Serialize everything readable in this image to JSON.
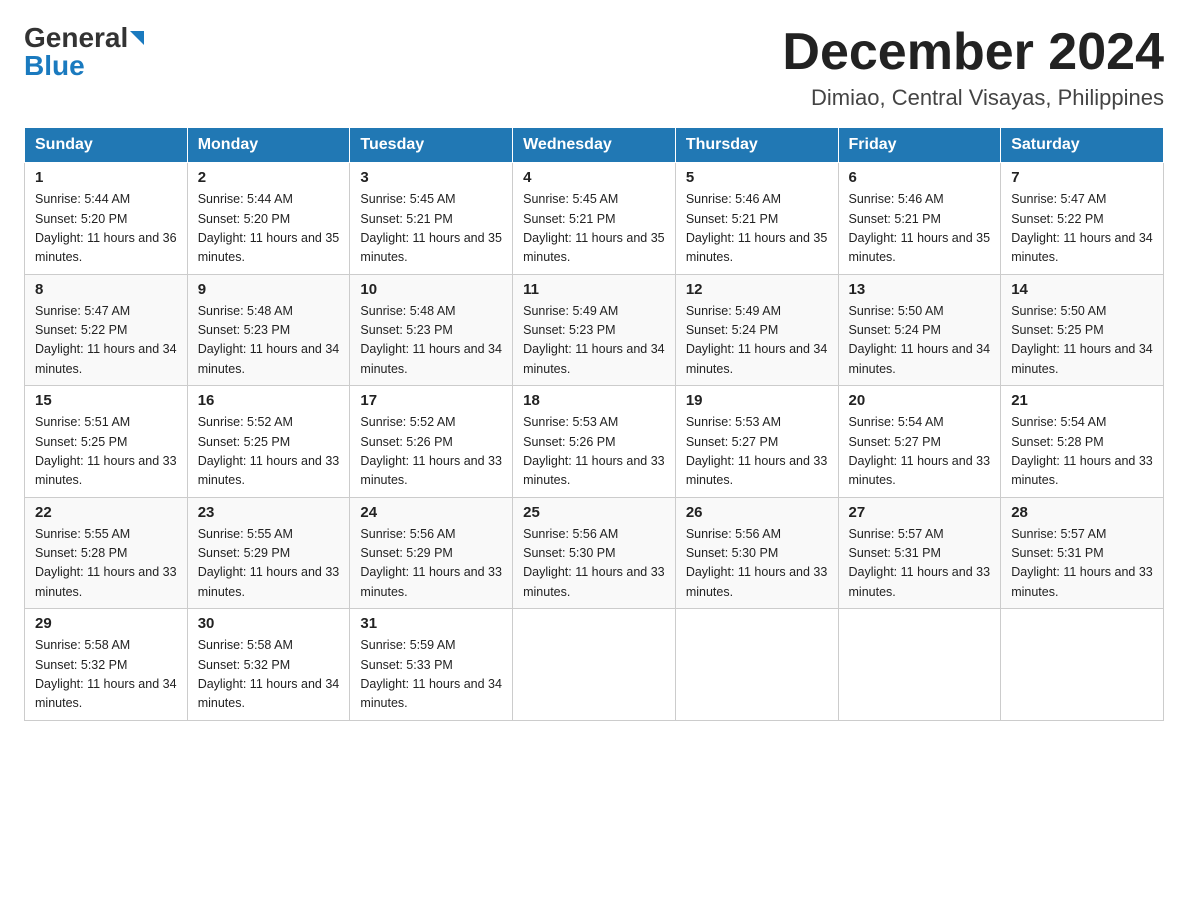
{
  "header": {
    "logo_general": "General",
    "logo_blue": "Blue",
    "month_title": "December 2024",
    "location": "Dimiao, Central Visayas, Philippines"
  },
  "days_of_week": [
    "Sunday",
    "Monday",
    "Tuesday",
    "Wednesday",
    "Thursday",
    "Friday",
    "Saturday"
  ],
  "weeks": [
    [
      {
        "day": "1",
        "sunrise": "5:44 AM",
        "sunset": "5:20 PM",
        "daylight": "11 hours and 36 minutes."
      },
      {
        "day": "2",
        "sunrise": "5:44 AM",
        "sunset": "5:20 PM",
        "daylight": "11 hours and 35 minutes."
      },
      {
        "day": "3",
        "sunrise": "5:45 AM",
        "sunset": "5:21 PM",
        "daylight": "11 hours and 35 minutes."
      },
      {
        "day": "4",
        "sunrise": "5:45 AM",
        "sunset": "5:21 PM",
        "daylight": "11 hours and 35 minutes."
      },
      {
        "day": "5",
        "sunrise": "5:46 AM",
        "sunset": "5:21 PM",
        "daylight": "11 hours and 35 minutes."
      },
      {
        "day": "6",
        "sunrise": "5:46 AM",
        "sunset": "5:21 PM",
        "daylight": "11 hours and 35 minutes."
      },
      {
        "day": "7",
        "sunrise": "5:47 AM",
        "sunset": "5:22 PM",
        "daylight": "11 hours and 34 minutes."
      }
    ],
    [
      {
        "day": "8",
        "sunrise": "5:47 AM",
        "sunset": "5:22 PM",
        "daylight": "11 hours and 34 minutes."
      },
      {
        "day": "9",
        "sunrise": "5:48 AM",
        "sunset": "5:23 PM",
        "daylight": "11 hours and 34 minutes."
      },
      {
        "day": "10",
        "sunrise": "5:48 AM",
        "sunset": "5:23 PM",
        "daylight": "11 hours and 34 minutes."
      },
      {
        "day": "11",
        "sunrise": "5:49 AM",
        "sunset": "5:23 PM",
        "daylight": "11 hours and 34 minutes."
      },
      {
        "day": "12",
        "sunrise": "5:49 AM",
        "sunset": "5:24 PM",
        "daylight": "11 hours and 34 minutes."
      },
      {
        "day": "13",
        "sunrise": "5:50 AM",
        "sunset": "5:24 PM",
        "daylight": "11 hours and 34 minutes."
      },
      {
        "day": "14",
        "sunrise": "5:50 AM",
        "sunset": "5:25 PM",
        "daylight": "11 hours and 34 minutes."
      }
    ],
    [
      {
        "day": "15",
        "sunrise": "5:51 AM",
        "sunset": "5:25 PM",
        "daylight": "11 hours and 33 minutes."
      },
      {
        "day": "16",
        "sunrise": "5:52 AM",
        "sunset": "5:25 PM",
        "daylight": "11 hours and 33 minutes."
      },
      {
        "day": "17",
        "sunrise": "5:52 AM",
        "sunset": "5:26 PM",
        "daylight": "11 hours and 33 minutes."
      },
      {
        "day": "18",
        "sunrise": "5:53 AM",
        "sunset": "5:26 PM",
        "daylight": "11 hours and 33 minutes."
      },
      {
        "day": "19",
        "sunrise": "5:53 AM",
        "sunset": "5:27 PM",
        "daylight": "11 hours and 33 minutes."
      },
      {
        "day": "20",
        "sunrise": "5:54 AM",
        "sunset": "5:27 PM",
        "daylight": "11 hours and 33 minutes."
      },
      {
        "day": "21",
        "sunrise": "5:54 AM",
        "sunset": "5:28 PM",
        "daylight": "11 hours and 33 minutes."
      }
    ],
    [
      {
        "day": "22",
        "sunrise": "5:55 AM",
        "sunset": "5:28 PM",
        "daylight": "11 hours and 33 minutes."
      },
      {
        "day": "23",
        "sunrise": "5:55 AM",
        "sunset": "5:29 PM",
        "daylight": "11 hours and 33 minutes."
      },
      {
        "day": "24",
        "sunrise": "5:56 AM",
        "sunset": "5:29 PM",
        "daylight": "11 hours and 33 minutes."
      },
      {
        "day": "25",
        "sunrise": "5:56 AM",
        "sunset": "5:30 PM",
        "daylight": "11 hours and 33 minutes."
      },
      {
        "day": "26",
        "sunrise": "5:56 AM",
        "sunset": "5:30 PM",
        "daylight": "11 hours and 33 minutes."
      },
      {
        "day": "27",
        "sunrise": "5:57 AM",
        "sunset": "5:31 PM",
        "daylight": "11 hours and 33 minutes."
      },
      {
        "day": "28",
        "sunrise": "5:57 AM",
        "sunset": "5:31 PM",
        "daylight": "11 hours and 33 minutes."
      }
    ],
    [
      {
        "day": "29",
        "sunrise": "5:58 AM",
        "sunset": "5:32 PM",
        "daylight": "11 hours and 34 minutes."
      },
      {
        "day": "30",
        "sunrise": "5:58 AM",
        "sunset": "5:32 PM",
        "daylight": "11 hours and 34 minutes."
      },
      {
        "day": "31",
        "sunrise": "5:59 AM",
        "sunset": "5:33 PM",
        "daylight": "11 hours and 34 minutes."
      },
      null,
      null,
      null,
      null
    ]
  ]
}
